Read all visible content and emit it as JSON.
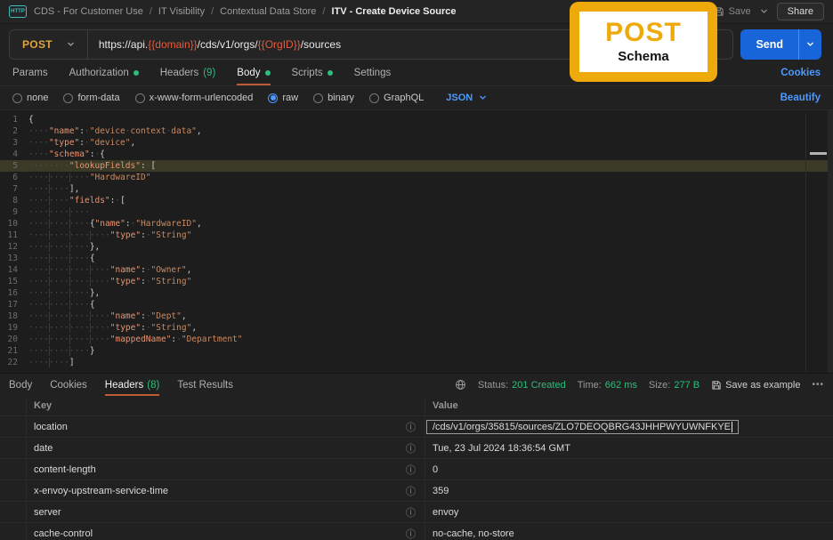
{
  "topbar": {
    "breadcrumb": [
      "CDS - For Customer Use",
      "IT Visibility",
      "Contextual Data Store",
      "ITV - Create Device Source"
    ],
    "save_label": "Save",
    "share_label": "Share"
  },
  "request": {
    "method": "POST",
    "url_parts": [
      {
        "text": "https://api.",
        "var": false
      },
      {
        "text": "{{domain}}",
        "var": true
      },
      {
        "text": "/cds/v1/orgs/",
        "var": false
      },
      {
        "text": "{{OrgID}}",
        "var": true
      },
      {
        "text": "/sources",
        "var": false
      }
    ],
    "send_label": "Send"
  },
  "request_tabs": {
    "tabs": [
      {
        "label": "Params"
      },
      {
        "label": "Authorization",
        "dot": true
      },
      {
        "label": "Headers",
        "count": "(9)"
      },
      {
        "label": "Body",
        "dot": true,
        "active": true
      },
      {
        "label": "Scripts",
        "dot": true
      },
      {
        "label": "Settings"
      }
    ],
    "cookies_link": "Cookies"
  },
  "body_options": {
    "radios": [
      {
        "label": "none"
      },
      {
        "label": "form-data"
      },
      {
        "label": "x-www-form-urlencoded"
      },
      {
        "label": "raw",
        "selected": true
      },
      {
        "label": "binary"
      },
      {
        "label": "GraphQL"
      }
    ],
    "language": "JSON",
    "beautify_link": "Beautify"
  },
  "editor": {
    "highlighted_line": 5,
    "lines": [
      "{",
      "    \"name\": \"device context data\",",
      "    \"type\": \"device\",",
      "    \"schema\": {",
      "        \"lookupFields\": [",
      "            \"HardwareID\"",
      "        ],",
      "        \"fields\": [",
      "            ",
      "            {\"name\": \"HardwareID\",",
      "                \"type\": \"String\"",
      "            },",
      "            {",
      "                \"name\": \"Owner\",",
      "                \"type\": \"String\"",
      "            },",
      "            {",
      "                \"name\": \"Dept\",",
      "                \"type\": \"String\",",
      "                \"mappedName\": \"Department\"",
      "            }",
      "        ]"
    ]
  },
  "response": {
    "tabs": [
      {
        "label": "Body"
      },
      {
        "label": "Cookies"
      },
      {
        "label": "Headers",
        "count": "(8)",
        "active": true
      },
      {
        "label": "Test Results"
      }
    ],
    "status_label": "Status:",
    "status_value": "201 Created",
    "time_label": "Time:",
    "time_value": "662 ms",
    "size_label": "Size:",
    "size_value": "277 B",
    "save_as_example_label": "Save as example",
    "more_label": "•••",
    "table": {
      "columns": [
        "Key",
        "Value"
      ],
      "rows": [
        {
          "key": "location",
          "value": "/cds/v1/orgs/35815/sources/ZLO7DEOQBRG43JHHPWYUWNFKYE",
          "selected": true
        },
        {
          "key": "date",
          "value": "Tue, 23 Jul 2024 18:36:54 GMT"
        },
        {
          "key": "content-length",
          "value": "0"
        },
        {
          "key": "x-envoy-upstream-service-time",
          "value": "359"
        },
        {
          "key": "server",
          "value": "envoy"
        },
        {
          "key": "cache-control",
          "value": "no-cache, no-store"
        }
      ]
    }
  },
  "badge": {
    "title": "POST",
    "subtitle": "Schema"
  },
  "colors": {
    "method_post": "#e0a53f",
    "variable_orange": "#e55c3c",
    "send_blue": "#1765d8",
    "link_blue": "#4c9aff",
    "status_green": "#2ebd7c",
    "tab_underline": "#bd5b39",
    "badge_gold": "#eea90b",
    "highlight_line": "#3b3a26"
  }
}
